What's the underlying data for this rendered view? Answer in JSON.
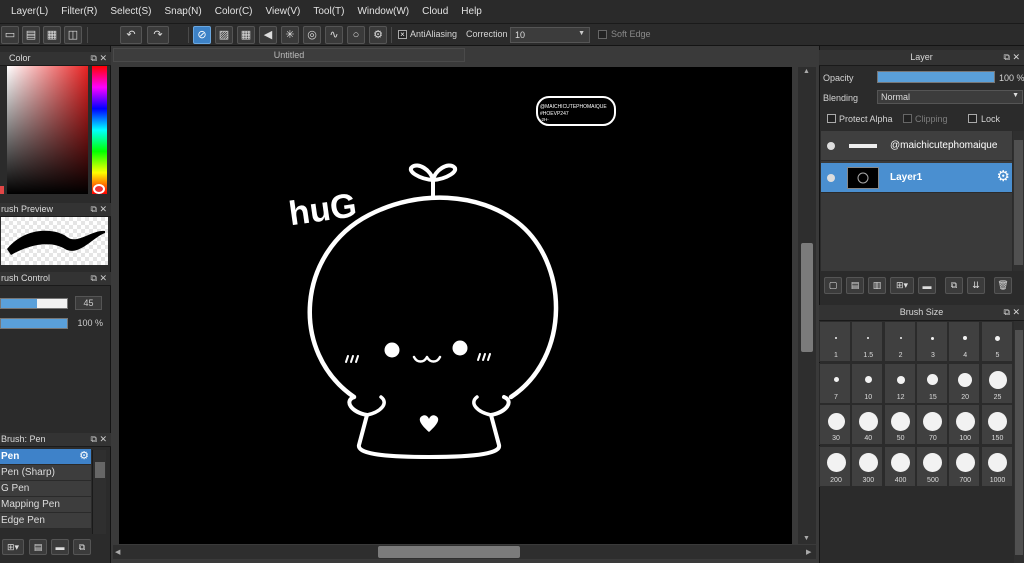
{
  "menu": [
    "Layer(L)",
    "Filter(R)",
    "Select(S)",
    "Snap(N)",
    "Color(C)",
    "View(V)",
    "Tool(T)",
    "Window(W)",
    "Cloud",
    "Help"
  ],
  "toolbar": {
    "antialiasing_label": "AntiAliasing",
    "correction_label": "Correction",
    "correction_value": "10",
    "soft_edge_label": "Soft Edge"
  },
  "left_panel": {
    "color_title": "Color",
    "brush_preview_title": "rush Preview",
    "brush_control_title": "rush Control",
    "brush_size_value": "45",
    "brush_opacity_value": "100 %",
    "brush_list_title": "Brush: Pen",
    "brushes": [
      "Pen",
      "Pen (Sharp)",
      "G Pen",
      "Mapping Pen",
      "Edge Pen"
    ]
  },
  "document": {
    "tab_title": "Untitled",
    "text_hug": "huG",
    "signature_line1": "@MAICHICUTEPHOMAIQUE",
    "signature_line2": "#HOEVP247",
    "signature_line3": "-2H-"
  },
  "layer_panel": {
    "title": "Layer",
    "opacity_label": "Opacity",
    "opacity_value": "100 %",
    "blending_label": "Blending",
    "blending_value": "Normal",
    "protect_alpha_label": "Protect Alpha",
    "clipping_label": "Clipping",
    "lock_label": "Lock",
    "layers": [
      {
        "name": "@maichicutephomaique",
        "selected": false
      },
      {
        "name": "Layer1",
        "selected": true
      }
    ]
  },
  "brush_size_panel": {
    "title": "Brush Size",
    "sizes": [
      "1",
      "1.5",
      "2",
      "3",
      "4",
      "5",
      "7",
      "10",
      "12",
      "15",
      "20",
      "25",
      "30",
      "40",
      "50",
      "70",
      "100",
      "150",
      "200",
      "300",
      "400",
      "500",
      "700",
      "1000"
    ]
  },
  "colors": {
    "accent": "#3e82c9",
    "panel_bg": "#2b2b2b",
    "canvas_bg": "#000000"
  }
}
